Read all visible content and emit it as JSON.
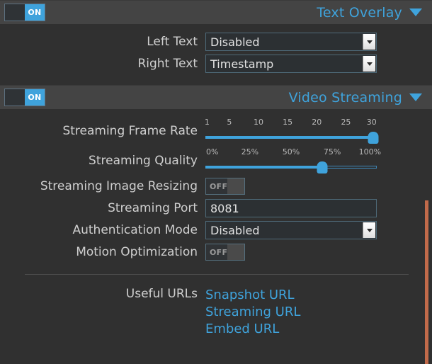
{
  "sections": [
    {
      "title": "Text Overlay",
      "toggle_state": "ON",
      "caret_icon": "chevron-down-icon",
      "rows": [
        {
          "label": "Left Text",
          "type": "select",
          "value": "Disabled"
        },
        {
          "label": "Right Text",
          "type": "select",
          "value": "Timestamp"
        }
      ]
    },
    {
      "title": "Video Streaming",
      "toggle_state": "ON",
      "caret_icon": "chevron-down-icon",
      "rows": [
        {
          "label": "Streaming Frame Rate",
          "type": "slider",
          "ticks": [
            "1",
            "5",
            "10",
            "15",
            "20",
            "25",
            "30"
          ],
          "tick_positions": [
            1,
            14,
            31,
            48,
            65,
            82,
            98
          ],
          "value": 30,
          "value_percent": 98
        },
        {
          "label": "Streaming Quality",
          "type": "slider",
          "ticks": [
            "0%",
            "25%",
            "50%",
            "75%",
            "100%"
          ],
          "tick_positions": [
            3,
            26,
            50,
            74,
            97
          ],
          "value": 70,
          "value_percent": 68
        },
        {
          "label": "Streaming Image Resizing",
          "type": "toggle",
          "value": "OFF"
        },
        {
          "label": "Streaming Port",
          "type": "text",
          "value": "8081"
        },
        {
          "label": "Authentication Mode",
          "type": "select",
          "value": "Disabled"
        },
        {
          "label": "Motion Optimization",
          "type": "toggle",
          "value": "OFF"
        }
      ],
      "urls": {
        "label": "Useful URLs",
        "links": [
          "Snapshot URL",
          "Streaming URL",
          "Embed URL"
        ]
      }
    }
  ],
  "colors": {
    "accent": "#3fa3dc",
    "header_bar": "#444444",
    "background": "#303030",
    "scrollbar_thumb": "#c16a4a"
  }
}
